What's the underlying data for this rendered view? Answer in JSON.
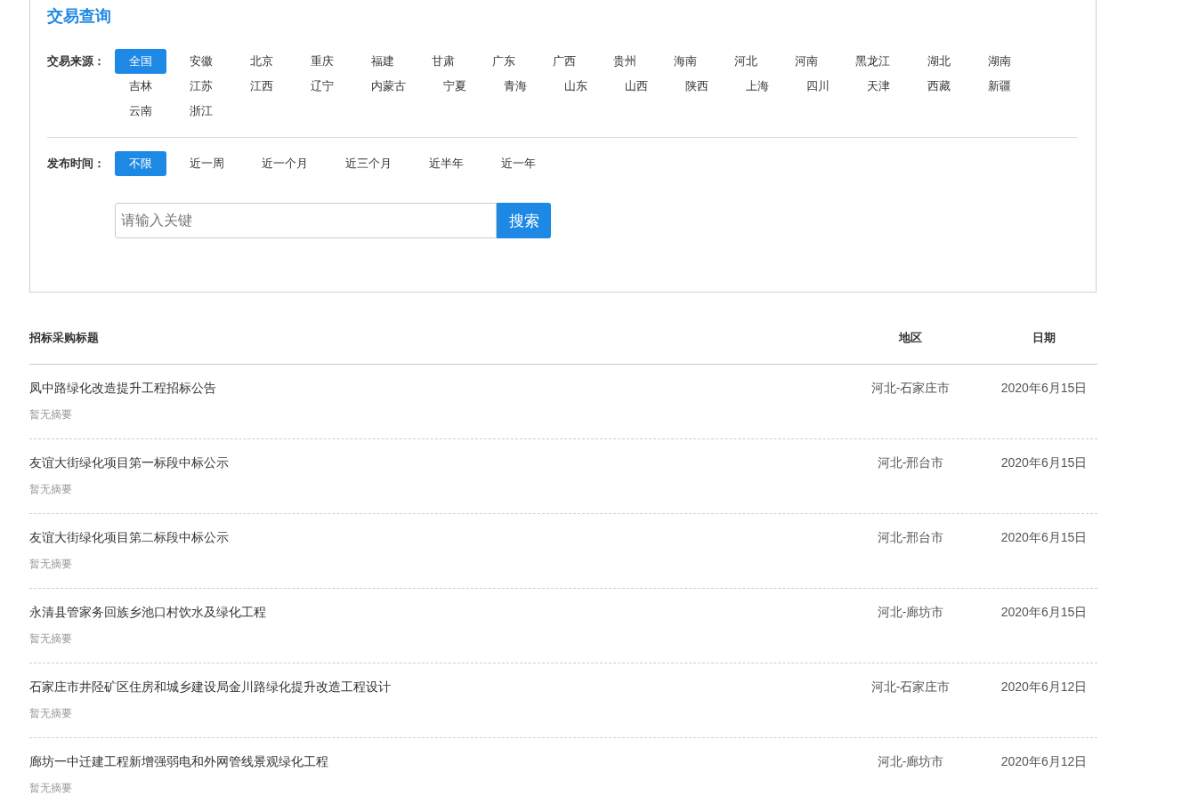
{
  "panel": {
    "title": "交易查询",
    "source_filter": {
      "label": "交易来源：",
      "options": [
        {
          "label": "全国",
          "selected": true
        },
        {
          "label": "安徽",
          "selected": false
        },
        {
          "label": "北京",
          "selected": false
        },
        {
          "label": "重庆",
          "selected": false
        },
        {
          "label": "福建",
          "selected": false
        },
        {
          "label": "甘肃",
          "selected": false
        },
        {
          "label": "广东",
          "selected": false
        },
        {
          "label": "广西",
          "selected": false
        },
        {
          "label": "贵州",
          "selected": false
        },
        {
          "label": "海南",
          "selected": false
        },
        {
          "label": "河北",
          "selected": false
        },
        {
          "label": "河南",
          "selected": false
        },
        {
          "label": "黑龙江",
          "selected": false
        },
        {
          "label": "湖北",
          "selected": false
        },
        {
          "label": "湖南",
          "selected": false
        },
        {
          "label": "吉林",
          "selected": false
        },
        {
          "label": "江苏",
          "selected": false
        },
        {
          "label": "江西",
          "selected": false
        },
        {
          "label": "辽宁",
          "selected": false
        },
        {
          "label": "内蒙古",
          "selected": false
        },
        {
          "label": "宁夏",
          "selected": false
        },
        {
          "label": "青海",
          "selected": false
        },
        {
          "label": "山东",
          "selected": false
        },
        {
          "label": "山西",
          "selected": false
        },
        {
          "label": "陕西",
          "selected": false
        },
        {
          "label": "上海",
          "selected": false
        },
        {
          "label": "四川",
          "selected": false
        },
        {
          "label": "天津",
          "selected": false
        },
        {
          "label": "西藏",
          "selected": false
        },
        {
          "label": "新疆",
          "selected": false
        },
        {
          "label": "云南",
          "selected": false
        },
        {
          "label": "浙江",
          "selected": false
        }
      ]
    },
    "time_filter": {
      "label": "发布时间：",
      "options": [
        {
          "label": "不限",
          "selected": true
        },
        {
          "label": "近一周",
          "selected": false
        },
        {
          "label": "近一个月",
          "selected": false
        },
        {
          "label": "近三个月",
          "selected": false
        },
        {
          "label": "近半年",
          "selected": false
        },
        {
          "label": "近一年",
          "selected": false
        }
      ]
    },
    "search": {
      "placeholder": "请输入关键",
      "button": "搜索"
    }
  },
  "table": {
    "columns": [
      "招标采购标题",
      "地区",
      "日期"
    ],
    "rows": [
      {
        "title": "凤中路绿化改造提升工程招标公告",
        "summary": "暂无摘要",
        "region": "河北-石家庄市",
        "date": "2020年6月15日"
      },
      {
        "title": "友谊大街绿化项目第一标段中标公示",
        "summary": "暂无摘要",
        "region": "河北-邢台市",
        "date": "2020年6月15日"
      },
      {
        "title": "友谊大街绿化项目第二标段中标公示",
        "summary": "暂无摘要",
        "region": "河北-邢台市",
        "date": "2020年6月15日"
      },
      {
        "title": "永清县管家务回族乡池口村饮水及绿化工程",
        "summary": "暂无摘要",
        "region": "河北-廊坊市",
        "date": "2020年6月15日"
      },
      {
        "title": "石家庄市井陉矿区住房和城乡建设局金川路绿化提升改造工程设计",
        "summary": "暂无摘要",
        "region": "河北-石家庄市",
        "date": "2020年6月12日"
      },
      {
        "title": "廊坊一中迁建工程新增强弱电和外网管线景观绿化工程",
        "summary": "暂无摘要",
        "region": "河北-廊坊市",
        "date": "2020年6月12日"
      }
    ]
  }
}
